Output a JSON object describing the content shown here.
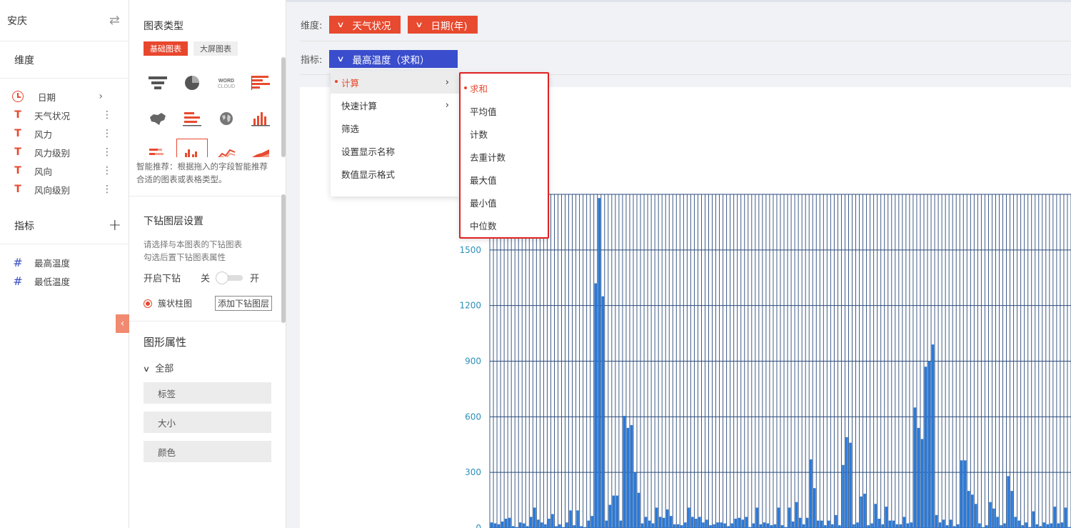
{
  "datasource": {
    "name": "安庆"
  },
  "left": {
    "dimension_title": "维度",
    "dimensions": [
      {
        "label": "日期",
        "icon": "clock-icon",
        "has_arrow": true
      },
      {
        "label": "天气状况",
        "icon": "text-type-icon"
      },
      {
        "label": "风力",
        "icon": "text-type-icon"
      },
      {
        "label": "风力级别",
        "icon": "text-type-icon"
      },
      {
        "label": "风向",
        "icon": "text-type-icon"
      },
      {
        "label": "风向级别",
        "icon": "text-type-icon"
      }
    ],
    "metric_title": "指标",
    "metrics": [
      {
        "label": "最高温度",
        "icon": "number-type-icon"
      },
      {
        "label": "最低温度",
        "icon": "number-type-icon"
      }
    ]
  },
  "middle": {
    "chart_type_title": "图表类型",
    "tabs": [
      "基础图表",
      "大屏图表"
    ],
    "word_cloud_lines": [
      "WORD",
      "CLOUD"
    ],
    "hint": "智能推荐：根据拖入的字段智能推荐合适的图表或表格类型。",
    "drill_title": "下钻图层设置",
    "drill_desc_1": "请选择与本图表的下钻图表",
    "drill_desc_2": "勾选后置下钻图表属性",
    "drill_switch_label": "开启下钻",
    "switch_off": "关",
    "switch_on": "开",
    "drill_layer": "簇状柱图",
    "add_drill_button": "添加下钻图层",
    "prop_title": "图形属性",
    "prop_all": "全部",
    "props": [
      "标签",
      "大小",
      "颜色"
    ]
  },
  "toolbar": {
    "dimension_label": "维度:",
    "dimension_pills": [
      "天气状况",
      "日期(年)"
    ],
    "metric_label": "指标:",
    "metric_pill": "最高温度（求和）"
  },
  "menu": {
    "items": [
      {
        "label": "计算",
        "sub": true,
        "active": true
      },
      {
        "label": "快速计算",
        "sub": true
      },
      {
        "label": "筛选"
      },
      {
        "label": "设置显示名称"
      },
      {
        "label": "数值显示格式"
      }
    ],
    "submenu": [
      "求和",
      "平均值",
      "计数",
      "去重计数",
      "最大值",
      "最小值",
      "中位数"
    ],
    "submenu_active": "求和"
  },
  "colors": {
    "accent_red": "#e84a2f",
    "accent_blue": "#3a4dcc",
    "bar_blue": "#2979d8"
  },
  "chart_data": {
    "type": "bar",
    "y_ticks": [
      "0",
      "300",
      "600",
      "900",
      "1200",
      "1500"
    ],
    "ylim": [
      0,
      1800
    ],
    "grid": true,
    "values": [
      30,
      25,
      20,
      35,
      50,
      55,
      10,
      5,
      30,
      25,
      10,
      60,
      110,
      45,
      30,
      20,
      50,
      75,
      10,
      20,
      5,
      30,
      95,
      15,
      95,
      10,
      5,
      40,
      65,
      1320,
      1780,
      1250,
      40,
      125,
      175,
      175,
      40,
      605,
      540,
      555,
      300,
      190,
      25,
      60,
      40,
      25,
      110,
      60,
      55,
      100,
      65,
      20,
      20,
      15,
      30,
      110,
      60,
      50,
      60,
      30,
      45,
      15,
      20,
      30,
      30,
      25,
      10,
      25,
      50,
      55,
      45,
      60,
      5,
      25,
      110,
      20,
      30,
      25,
      15,
      20,
      110,
      15,
      5,
      110,
      35,
      140,
      55,
      20,
      55,
      370,
      215,
      40,
      40,
      15,
      40,
      20,
      70,
      15,
      340,
      490,
      460,
      20,
      30,
      170,
      185,
      15,
      25,
      130,
      50,
      20,
      115,
      40,
      40,
      20,
      20,
      60,
      25,
      30,
      650,
      540,
      480,
      870,
      900,
      990,
      70,
      30,
      45,
      15,
      45,
      10,
      20,
      365,
      365,
      200,
      180,
      130,
      25,
      5,
      15,
      140,
      105,
      60,
      15,
      25,
      280,
      200,
      60,
      40,
      15,
      30,
      5,
      90,
      20,
      10,
      30,
      20,
      25,
      115,
      25,
      30,
      110,
      5
    ]
  }
}
